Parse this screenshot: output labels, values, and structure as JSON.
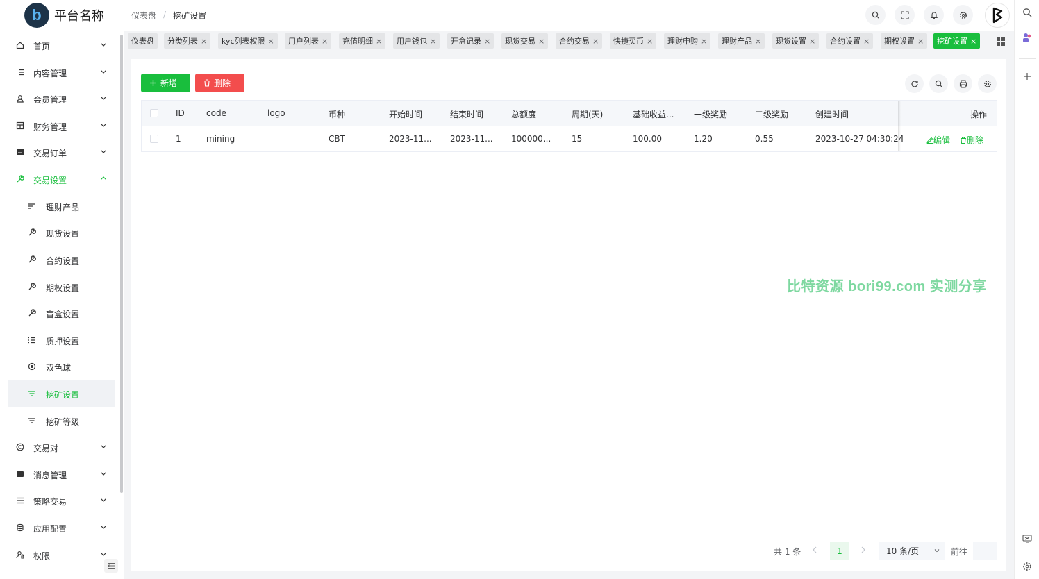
{
  "header": {
    "logo_letter": "b",
    "brand": "平台名称",
    "breadcrumb": [
      "仪表盘",
      "挖矿设置"
    ],
    "breadcrumb_sep": "/"
  },
  "sidebar": {
    "items": [
      {
        "label": "首页",
        "icon": "home-icon"
      },
      {
        "label": "内容管理",
        "icon": "list-icon"
      },
      {
        "label": "会员管理",
        "icon": "user-icon"
      },
      {
        "label": "财务管理",
        "icon": "wallet-icon"
      },
      {
        "label": "交易订单",
        "icon": "order-icon"
      },
      {
        "label": "交易设置",
        "icon": "wrench-icon",
        "expanded": true
      }
    ],
    "subitems": [
      {
        "label": "理财产品",
        "icon": "sort-icon"
      },
      {
        "label": "现货设置",
        "icon": "wrench-icon"
      },
      {
        "label": "合约设置",
        "icon": "wrench-icon"
      },
      {
        "label": "期权设置",
        "icon": "wrench-icon"
      },
      {
        "label": "盲盒设置",
        "icon": "wrench-icon"
      },
      {
        "label": "质押设置",
        "icon": "list-icon"
      },
      {
        "label": "双色球",
        "icon": "radio-icon"
      },
      {
        "label": "挖矿设置",
        "icon": "sort-icon",
        "active": true
      },
      {
        "label": "挖矿等级",
        "icon": "sort-icon"
      }
    ],
    "items_after": [
      {
        "label": "交易对",
        "icon": "copyright-icon"
      },
      {
        "label": "消息管理",
        "icon": "message-icon"
      },
      {
        "label": "策略交易",
        "icon": "menu-icon"
      },
      {
        "label": "应用配置",
        "icon": "coin-icon"
      },
      {
        "label": "权限",
        "icon": "user-lock-icon"
      }
    ]
  },
  "tabs": [
    {
      "label": "仪表盘",
      "closable": false
    },
    {
      "label": "分类列表"
    },
    {
      "label": "kyc列表权限"
    },
    {
      "label": "用户列表"
    },
    {
      "label": "充值明细"
    },
    {
      "label": "用户钱包"
    },
    {
      "label": "开盒记录"
    },
    {
      "label": "现货交易"
    },
    {
      "label": "合约交易"
    },
    {
      "label": "快捷买币"
    },
    {
      "label": "理财申购"
    },
    {
      "label": "理财产品"
    },
    {
      "label": "现货设置"
    },
    {
      "label": "合约设置"
    },
    {
      "label": "期权设置"
    },
    {
      "label": "挖矿设置",
      "active": true
    }
  ],
  "tab_close_glyph": "×",
  "toolbar": {
    "add_label": "新增",
    "delete_label": "删除"
  },
  "table": {
    "columns": [
      "ID",
      "code",
      "logo",
      "币种",
      "开始时间",
      "结束时间",
      "总额度",
      "周期(天)",
      "基础收益...",
      "一级奖励",
      "二级奖励",
      "创建时间",
      "操作"
    ],
    "rows": [
      {
        "cells": [
          "1",
          "mining",
          "",
          "CBT",
          "2023-11...",
          "2023-11...",
          "100000...",
          "15",
          "100.00",
          "1.20",
          "0.55",
          "2023-10-27 04:30:24"
        ],
        "actions": [
          "编辑",
          "删除"
        ]
      }
    ]
  },
  "pagination": {
    "total": "共 1 条",
    "current_page": "1",
    "page_size": "10 条/页",
    "goto_label": "前往",
    "goto_value": ""
  },
  "watermark": "比特资源 bori99.com 实测分享",
  "colors": {
    "primary": "#19be3d",
    "danger": "#f34d4d",
    "background": "#f3f4f6"
  }
}
